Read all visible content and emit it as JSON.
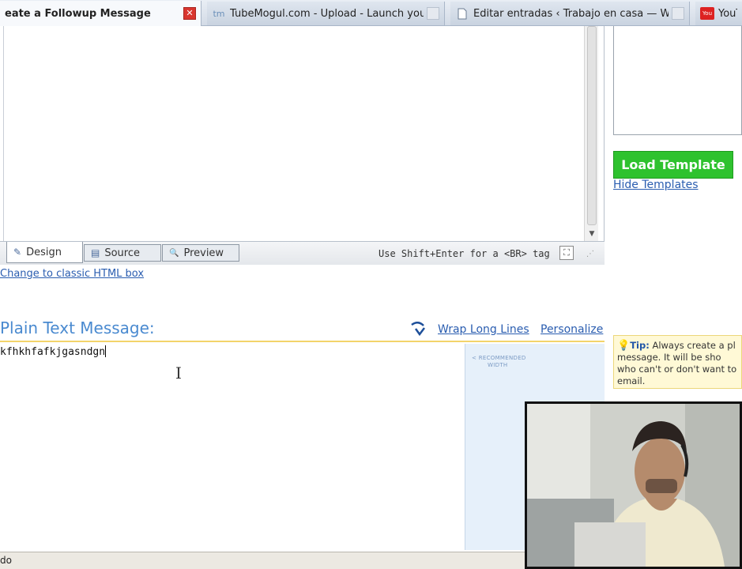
{
  "tabs": [
    {
      "label": "eate a Followup Message",
      "favicon": "",
      "close": "✕",
      "active": true
    },
    {
      "label": "TubeMogul.com - Upload - Launch your...",
      "favicon": "tm",
      "close": "",
      "active": false
    },
    {
      "label": "Editar entradas ‹ Trabajo en casa — W...",
      "favicon": "doc",
      "close": "",
      "active": false
    },
    {
      "label": "YouT",
      "favicon": "You",
      "close": "",
      "active": false
    }
  ],
  "editor": {
    "tabs": [
      {
        "label": "Design",
        "icon": "pencil-icon",
        "glyph": "✎"
      },
      {
        "label": "Source",
        "icon": "source-icon",
        "glyph": "▤"
      },
      {
        "label": "Preview",
        "icon": "preview-icon",
        "glyph": "🔍"
      }
    ],
    "shift_hint": "Use Shift+Enter for a <BR> tag",
    "scroll_down": "▼",
    "fullscreen_glyph": "⛶",
    "grip_glyph": "⋰"
  },
  "classic_link": "Change to classic HTML box",
  "templates": {
    "load_button": "Load Template",
    "hide_link": "Hide Templates"
  },
  "plain_text": {
    "title": "Plain Text Message:",
    "wrap_link": "Wrap Long Lines",
    "personalize_link": "Personalize",
    "content": "kfhkhfafkjgasndgn",
    "recommended": "< RECOMMENDED",
    "recommended_line2": "WIDTH",
    "cursor_glyph": "I"
  },
  "tip": {
    "bulb": "💡",
    "label": "Tip:",
    "text": " Always create a pl message. It will be sho who can't or don't want to email."
  },
  "status": {
    "text": "do"
  },
  "colors": {
    "accent_green": "#2ec22e",
    "link_blue": "#2a5db0",
    "title_blue": "#4a8ad0",
    "active_tab_close": "#d9362f"
  }
}
